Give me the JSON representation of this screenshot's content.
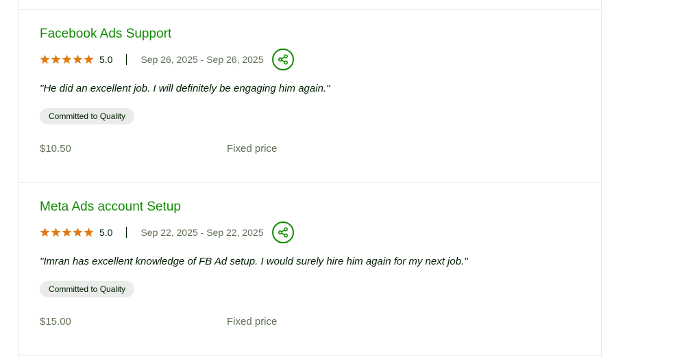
{
  "colors": {
    "accent": "#108a00",
    "star": "#e07b14",
    "muted_text": "#5e6d55",
    "badge_bg": "#e9ece9",
    "divider": "#e4ebe4"
  },
  "reviews": [
    {
      "title": "Facebook Ads Support",
      "rating": "5.0",
      "stars": 5,
      "dates": "Sep 26, 2025 - Sep 26, 2025",
      "share_icon": "share-icon",
      "quote": "\"He did an excellent job. I will definitely be engaging him again.\"",
      "badge": "Committed to Quality",
      "price": "$10.50",
      "price_type": "Fixed price"
    },
    {
      "title": "Meta Ads account Setup",
      "rating": "5.0",
      "stars": 5,
      "dates": "Sep 22, 2025 - Sep 22, 2025",
      "share_icon": "share-icon",
      "quote": "\"Imran has excellent knowledge of FB Ad setup. I would surely hire him again for my next job.\"",
      "badge": "Committed to Quality",
      "price": "$15.00",
      "price_type": "Fixed price"
    }
  ]
}
